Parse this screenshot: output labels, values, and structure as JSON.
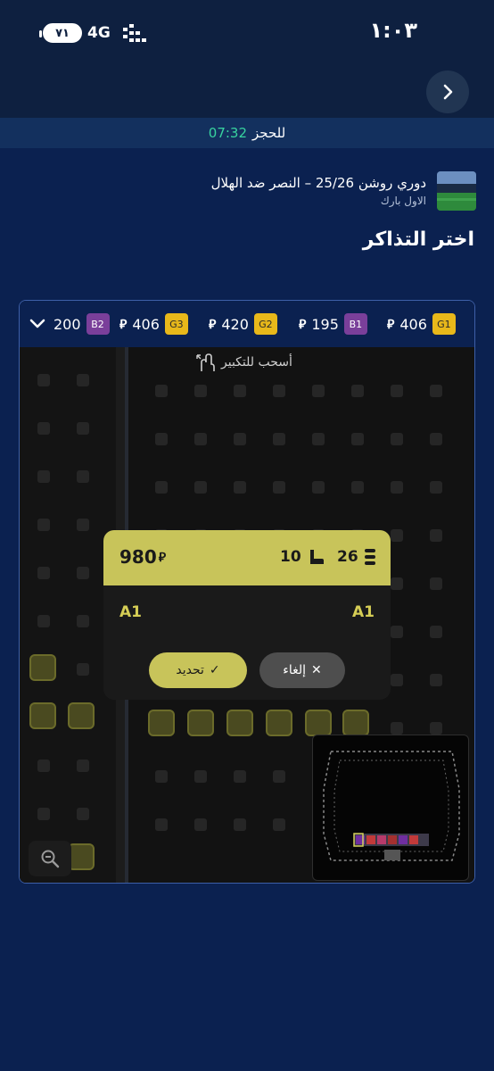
{
  "status_bar": {
    "time": "١:٠٣",
    "battery": "٧١",
    "network": "4G",
    "icons": [
      "battery-icon",
      "signal-icon"
    ]
  },
  "nav": {
    "back_icon": "chevron-right-icon"
  },
  "booking_timer": {
    "value": "07:32",
    "label": "للحجز"
  },
  "event": {
    "title": "دوري روشن 25/26 – النصر ضد الهلال",
    "venue": "الاول بارك"
  },
  "page_title": "اختر التذاكر",
  "price_categories": [
    {
      "code": "G1",
      "price": "406",
      "currency": "⃁",
      "color": "#e8b81a"
    },
    {
      "code": "B1",
      "price": "195",
      "currency": "⃁",
      "color": "#7a3f9a"
    },
    {
      "code": "G2",
      "price": "420",
      "currency": "⃁",
      "color": "#e8b81a"
    },
    {
      "code": "G3",
      "price": "406",
      "currency": "⃁",
      "color": "#e8b81a"
    },
    {
      "code": "B2",
      "price": "200",
      "currency": "",
      "color": "#7a3f9a"
    }
  ],
  "seat_map": {
    "drag_hint": "أسحب للتكبير",
    "zoom_icon": "zoom-out-icon",
    "expand_icon": "chevron-down-icon"
  },
  "seat_popup": {
    "price": "980",
    "currency": "⃁",
    "seat_number": "10",
    "row_number": "26",
    "seat_label_left": "A1",
    "seat_label_right": "A1",
    "confirm_label": "تحديد",
    "cancel_label": "إلغاء"
  },
  "colors": {
    "background": "#0b2150",
    "accent": "#c8c45a",
    "timer": "#38d39f"
  }
}
